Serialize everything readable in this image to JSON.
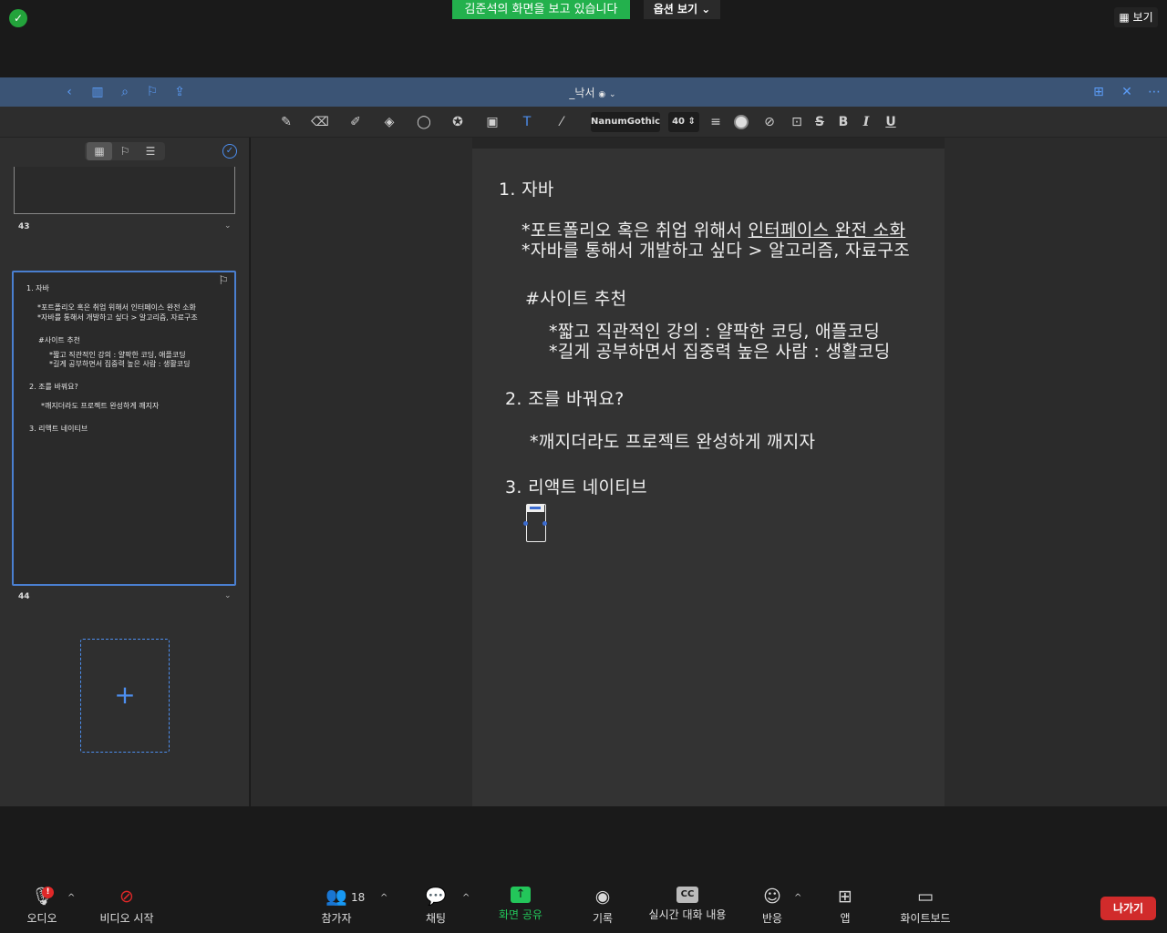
{
  "zoom_top": {
    "viewing_banner": "김준석의 화면을 보고 있습니다",
    "options_label": "옵션 보기",
    "view_label": "보기"
  },
  "app": {
    "doc_title": "_낙서"
  },
  "toolbar": {
    "font_name": "NanumGothic",
    "font_size": "40",
    "bold": "B",
    "italic": "I",
    "underline": "U",
    "strike": "S"
  },
  "sidebar": {
    "pages": [
      {
        "number": "43"
      },
      {
        "number": "44"
      }
    ],
    "add_page": "+",
    "thumb_lines": [
      "1. 자바",
      "*포트폴리오 혹은 취업 위해서 인터페이스 완전 소화",
      "*자바를 통해서 개발하고 싶다 > 알고리즘, 자료구조",
      "#사이트 추천",
      "*짧고 직관적인 강의 : 얄팍한 코딩, 애플코딩",
      "*길게 공부하면서 집중력 높은 사람 : 생활코딩",
      "2. 조를 바꿔요?",
      "*깨지더라도 프로젝트 완성하게 깨지자",
      "3. 리액트 네이티브"
    ]
  },
  "note": {
    "heading1": "1. 자바",
    "line1_prefix": "*포트폴리오 혹은 취업 위해서 ",
    "line1_underlined": "인터페이스 완전 소화",
    "line2": "*자바를 통해서 개발하고 싶다 > 알고리즘, 자료구조",
    "site_heading": "#사이트 추천",
    "site1": "*짧고 직관적인 강의 : 얄팍한 코딩, 애플코딩",
    "site2": "*길게 공부하면서 집중력 높은 사람 : 생활코딩",
    "heading2": "2. 조를 바꿔요?",
    "line3": "*깨지더라도 프로젝트 완성하게 깨지자",
    "heading3": "3. 리액트 네이티브"
  },
  "bottom_bar": {
    "audio": "오디오",
    "audio_badge": "!",
    "video": "비디오 시작",
    "participants": "참가자",
    "participants_count": "18",
    "chat": "채팅",
    "share": "화면 공유",
    "record": "기록",
    "captions": "실시간 대화 내용",
    "reactions": "반응",
    "apps": "앱",
    "whiteboard": "화이트보드",
    "leave": "나가기",
    "cc": "CC"
  }
}
